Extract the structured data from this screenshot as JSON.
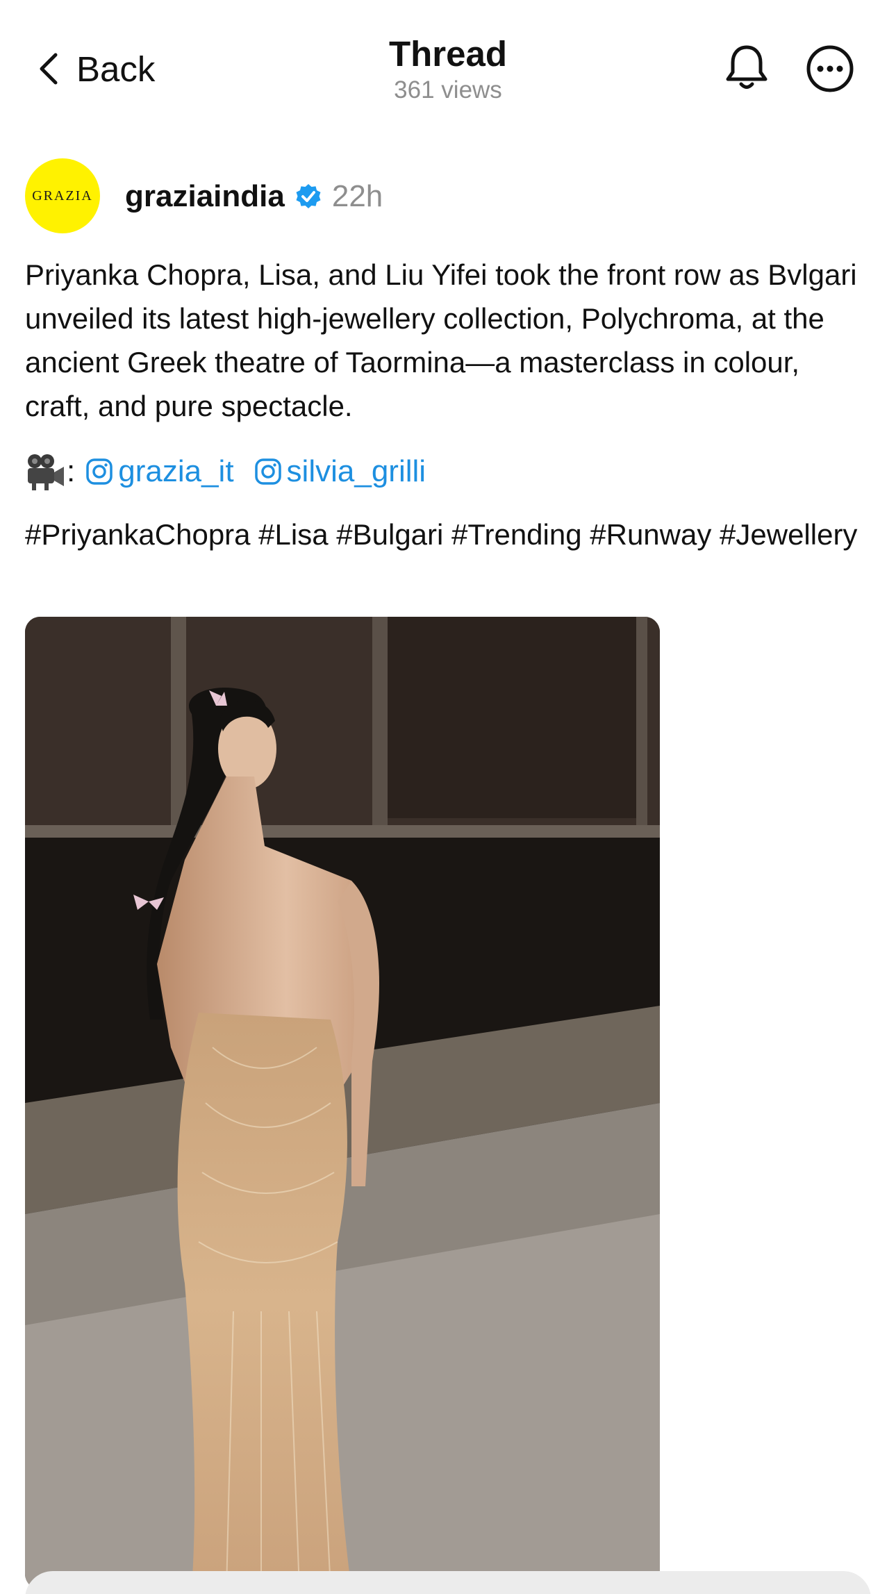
{
  "header": {
    "back_label": "Back",
    "title": "Thread",
    "views": "361 views",
    "icons": [
      "chevron-left-icon",
      "bell-icon",
      "more-icon"
    ]
  },
  "post": {
    "avatar_text": "GRAZIA",
    "username": "graziaindia",
    "verified": true,
    "time": "22h",
    "text": "Priyanka Chopra, Lisa, and Liu Yifei took the front row as Bvlgari unveiled its latest high-jewellery collection, Polychroma, at the ancient Greek theatre of Taormina—a masterclass in colour, craft, and pure spectacle.",
    "credits_prefix": ":",
    "mentions": [
      "grazia_it",
      "silvia_grilli"
    ],
    "hashtags": "#PriyankaChopra #Lisa #Bulgari #Trending #Runway #Jewellery"
  },
  "colors": {
    "link": "#1d8fe0",
    "verified": "#1d9bf0",
    "avatar_bg": "#fff200",
    "muted": "#8e8e8e"
  }
}
